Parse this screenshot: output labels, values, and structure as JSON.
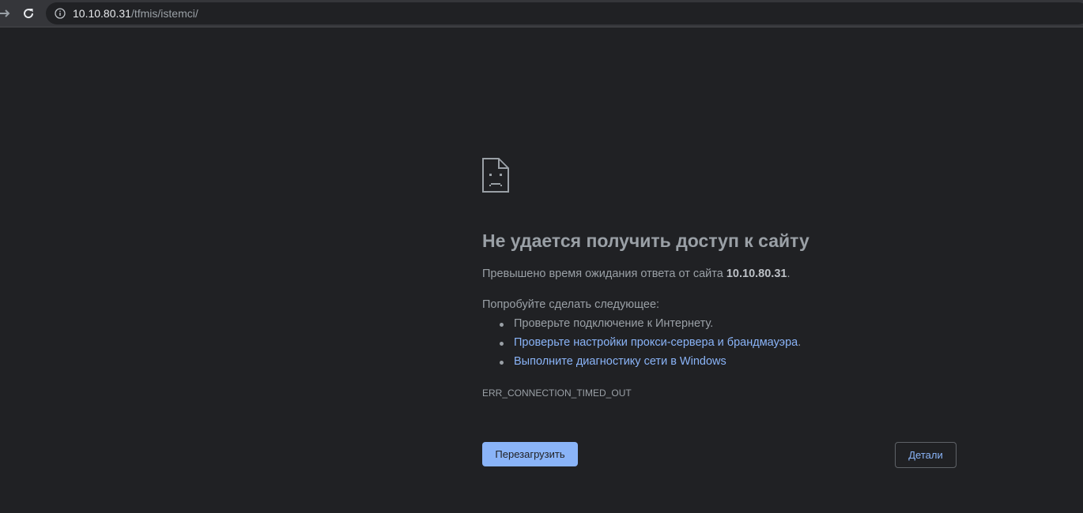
{
  "browser": {
    "url_host": "10.10.80.31",
    "url_path": "/tfmis/istemci/",
    "icons": {
      "forward": "forward-arrow-icon",
      "reload": "reload-icon",
      "info": "info-icon"
    }
  },
  "error_page": {
    "icon": "sad-document-icon",
    "title": "Не удается получить доступ к сайту",
    "description_prefix": "Превышено время ожидания ответа от сайта ",
    "description_host": "10.10.80.31",
    "description_suffix": ".",
    "try_heading": "Попробуйте сделать следующее:",
    "suggestions": [
      "Проверьте подключение к Интернету.",
      "Проверьте настройки прокси-сервера и брандмауэра",
      "Выполните диагностику сети в Windows"
    ],
    "suggestion_2_tail": ".",
    "error_code": "ERR_CONNECTION_TIMED_OUT",
    "reload_label": "Перезагрузить",
    "details_label": "Детали"
  },
  "colors": {
    "background": "#202124",
    "text": "#9aa0a6",
    "link": "#8ab4f8",
    "primary_button": "#8ab4f8"
  }
}
